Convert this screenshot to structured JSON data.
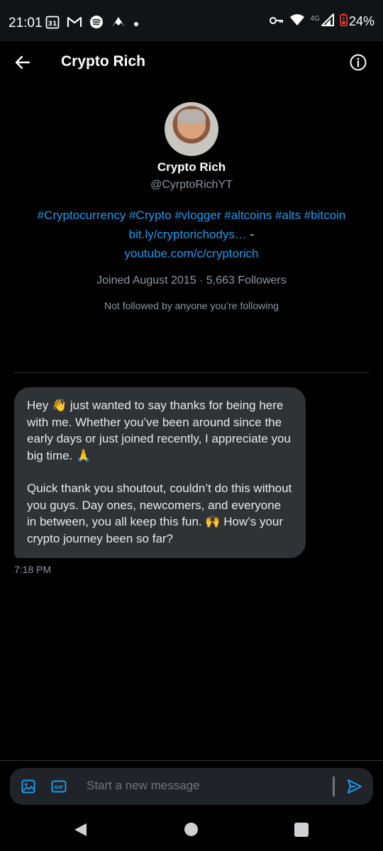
{
  "status_bar": {
    "time": "21:01",
    "calendar_day": "31",
    "network": "4G",
    "battery": "24%"
  },
  "header": {
    "title": "Crypto Rich"
  },
  "profile": {
    "name": "Crypto Rich",
    "handle": "@CyrptoRichYT",
    "bio_tags": "#Cryptocurrency #Crypto #vlogger #altcoins #alts #bitcoin",
    "bio_link": "bit.ly/cryptorichodys…",
    "bio_sep": " -",
    "bio_link2": "youtube.com/c/cryptorich",
    "joined": "Joined August 2015",
    "followers": "5,663 Followers",
    "not_followed": "Not followed by anyone you’re following"
  },
  "message": {
    "paragraph1": "Hey 👋 just wanted to say thanks for being here with me. Whether you’ve been around since the early days or just joined recently, I appreciate you big time. 🙏",
    "paragraph2": "Quick thank you shoutout, couldn’t do this without you guys. Day ones, newcomers, and everyone in between, you all keep this fun. 🙌 How’s your crypto journey been so far?",
    "time": "7:18 PM"
  },
  "composer": {
    "placeholder": "Start a new message"
  },
  "colors": {
    "accent": "#1d9bf0",
    "background": "#000000",
    "bubble": "#2f3336"
  }
}
